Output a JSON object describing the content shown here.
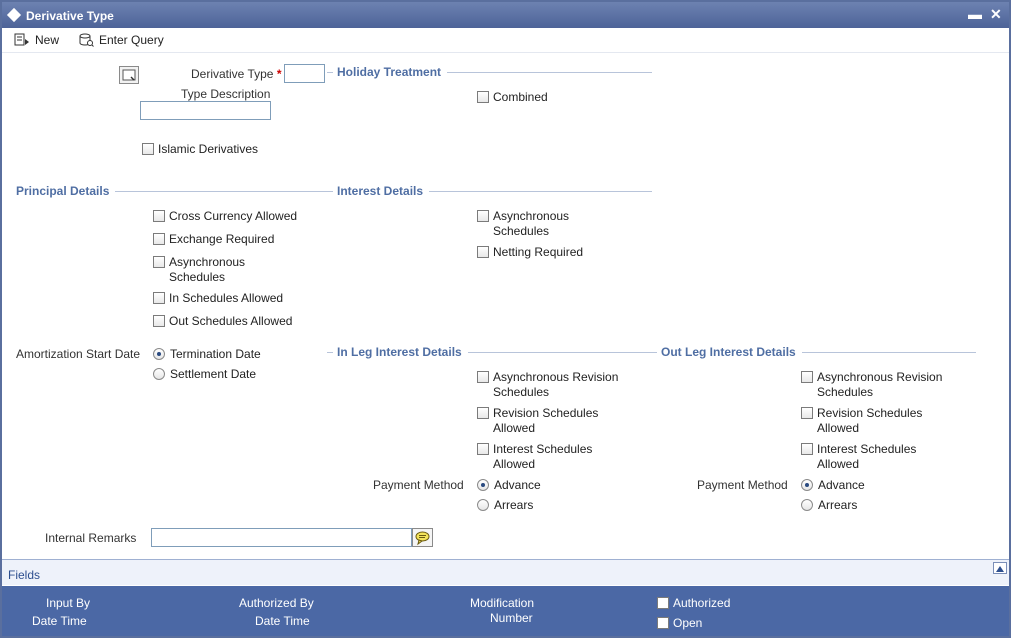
{
  "window": {
    "title": "Derivative Type",
    "minimize_glyph": "▬",
    "close_glyph": "✕"
  },
  "toolbar": {
    "new_label": "New",
    "enter_query_label": "Enter Query"
  },
  "header": {
    "derivative_type_label": "Derivative Type",
    "required_marker": "*",
    "derivative_type_value": "",
    "type_description_label": "Type Description",
    "type_description_value": "",
    "islamic_derivatives_label": "Islamic Derivatives"
  },
  "holiday_treatment": {
    "title": "Holiday Treatment",
    "combined_label": "Combined"
  },
  "principal_details": {
    "title": "Principal Details",
    "cross_currency_label": "Cross Currency Allowed",
    "exchange_required_label": "Exchange Required",
    "async_schedules_label": "Asynchronous Schedules",
    "in_schedules_label": "In Schedules Allowed",
    "out_schedules_label": "Out Schedules Allowed"
  },
  "interest_details": {
    "title": "Interest Details",
    "async_schedules_label": "Asynchronous Schedules",
    "netting_required_label": "Netting Required"
  },
  "amortization": {
    "label": "Amortization Start Date",
    "termination_label": "Termination Date",
    "settlement_label": "Settlement Date",
    "selected": "Termination Date"
  },
  "in_leg": {
    "title": "In Leg Interest Details",
    "async_revision_label": "Asynchronous Revision Schedules",
    "revision_schedules_label": "Revision Schedules Allowed",
    "interest_schedules_label": "Interest Schedules Allowed",
    "payment_method_label": "Payment Method",
    "advance_label": "Advance",
    "arrears_label": "Arrears",
    "selected": "Advance"
  },
  "out_leg": {
    "title": "Out Leg Interest Details",
    "async_revision_label": "Asynchronous Revision Schedules",
    "revision_schedules_label": "Revision Schedules Allowed",
    "interest_schedules_label": "Interest Schedules Allowed",
    "payment_method_label": "Payment Method",
    "advance_label": "Advance",
    "arrears_label": "Arrears",
    "selected": "Advance"
  },
  "remarks": {
    "label": "Internal Remarks",
    "value": ""
  },
  "fields_bar": {
    "label": "Fields"
  },
  "footer": {
    "input_by_label": "Input By",
    "input_date_time_label": "Date Time",
    "authorized_by_label": "Authorized By",
    "auth_date_time_label": "Date Time",
    "modification_label": "Modification",
    "number_label": "Number",
    "authorized_label": "Authorized",
    "open_label": "Open"
  },
  "colors": {
    "titlebar": "#4d6398",
    "section_title": "#4f6ea3",
    "footer": "#4b68a5"
  },
  "icons": {
    "new": "new-icon",
    "enter_query": "enter-query-icon",
    "lov": "lov-icon",
    "remarks": "speech-bubble-icon"
  }
}
